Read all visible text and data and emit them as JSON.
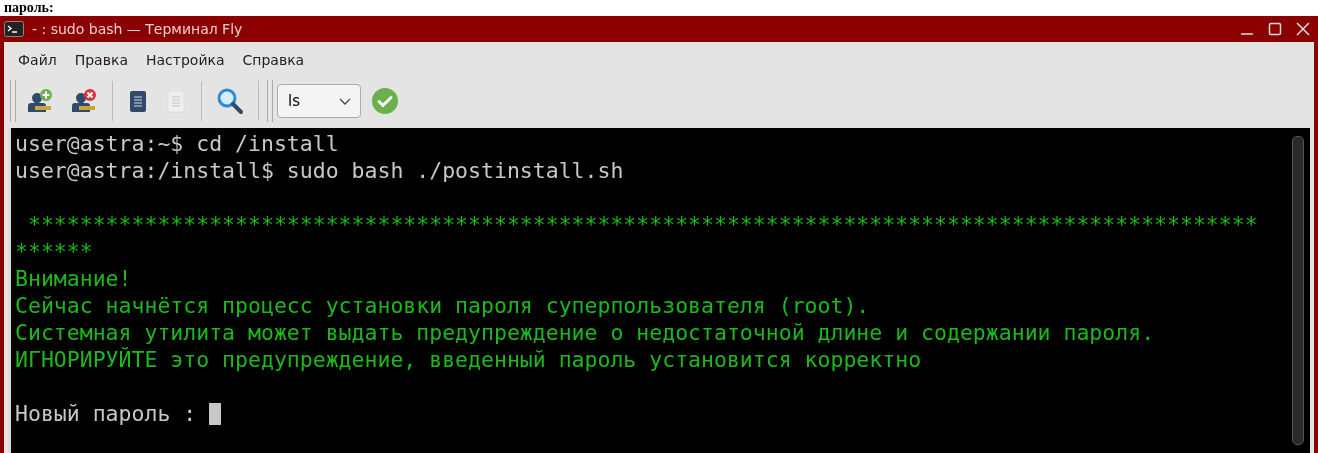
{
  "caption": "пароль:",
  "window": {
    "title": "- : sudo bash — Терминал Fly"
  },
  "menu": [
    "Файл",
    "Правка",
    "Настройка",
    "Справка"
  ],
  "toolbar": {
    "buttons": [
      {
        "kind": "add-user",
        "disabled": false
      },
      {
        "kind": "remove-user",
        "disabled": false
      },
      {
        "kind": "copy",
        "disabled": false
      },
      {
        "kind": "paste",
        "disabled": true
      },
      {
        "kind": "search",
        "disabled": false
      }
    ],
    "command": {
      "value": "ls"
    }
  },
  "terminal": {
    "lines": [
      {
        "kind": "plain",
        "text": "user@astra:~$ cd /install",
        "cursor": false
      },
      {
        "kind": "plain",
        "text": "user@astra:/install$ sudo bash ./postinstall.sh",
        "cursor": false
      },
      {
        "kind": "blank",
        "cursor": false
      },
      {
        "kind": "notice",
        "text": " ***********************************************************************************************",
        "cursor": false
      },
      {
        "kind": "notice",
        "text": "******",
        "cursor": false
      },
      {
        "kind": "notice",
        "text": "Внимание!",
        "cursor": false
      },
      {
        "kind": "notice",
        "text": "Сейчас начнётся процесс установки пароля суперпользователя (root).",
        "cursor": false
      },
      {
        "kind": "notice",
        "text": "Системная утилита может выдать предупреждение о недостаточной длине и содержании пароля.",
        "cursor": false
      },
      {
        "kind": "notice",
        "text": "ИГНОРИРУЙТЕ это предупреждение, введенный пароль установится корректно",
        "cursor": false
      },
      {
        "kind": "blank",
        "cursor": false
      },
      {
        "kind": "plain",
        "text": "Новый пароль : ",
        "cursor": true
      }
    ]
  }
}
